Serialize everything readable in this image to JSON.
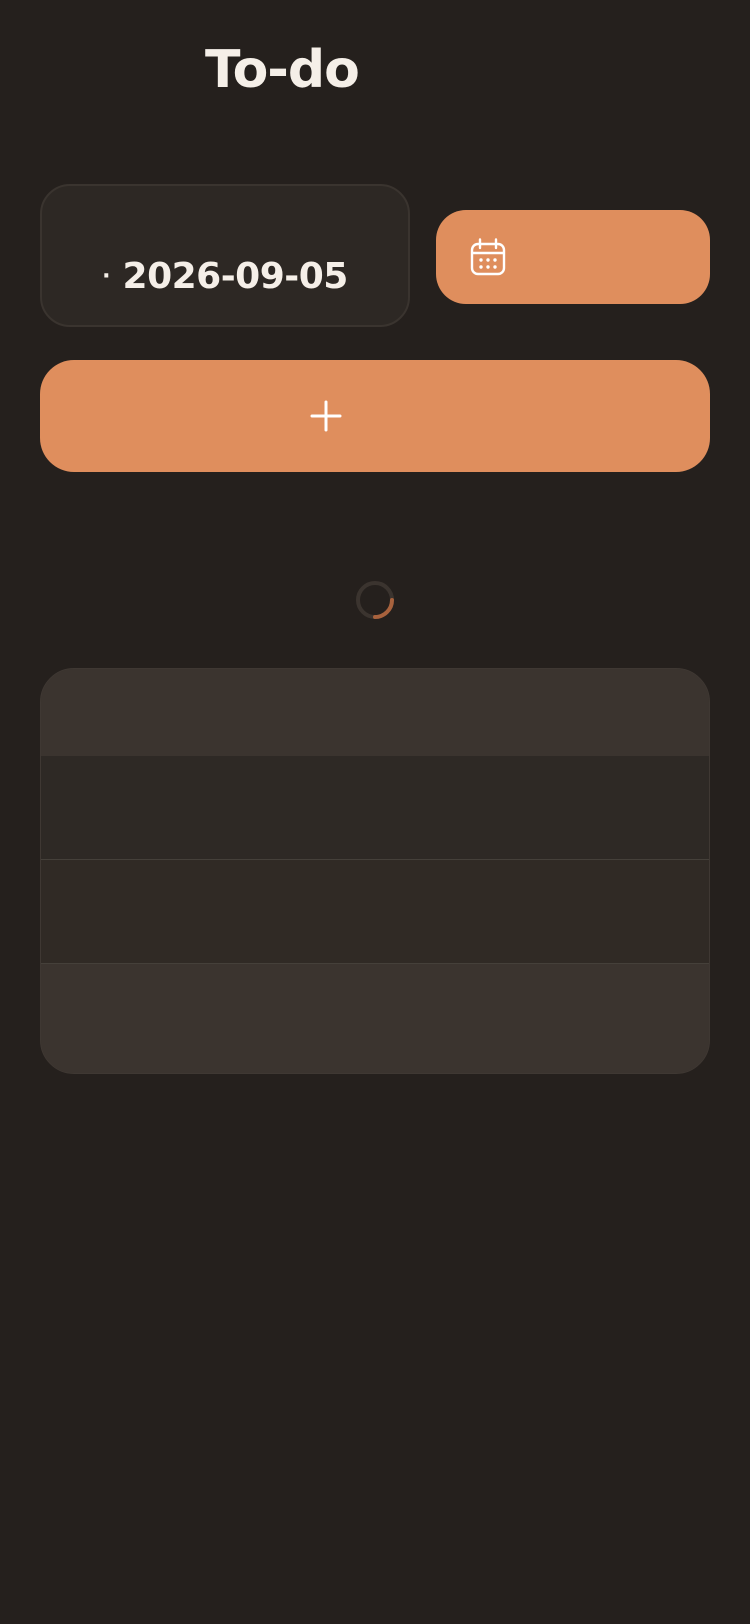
{
  "header": {
    "title": "To-do"
  },
  "date_picker": {
    "bullet": "·",
    "value": "2026-09-05"
  },
  "calendar_button": {
    "icon": "calendar-icon",
    "label": ""
  },
  "add_button": {
    "icon": "plus-icon",
    "label": ""
  },
  "loading": {
    "icon": "spinner-icon"
  },
  "task_table": {
    "header": "",
    "rows": [
      {
        "text": ""
      },
      {
        "text": ""
      }
    ],
    "footer": ""
  },
  "colors": {
    "background": "#25201d",
    "card": "#2d2824",
    "accent": "#df8e5d",
    "text": "#f5efe8",
    "table_header": "#3b342f",
    "table_row": "#2e2925"
  }
}
